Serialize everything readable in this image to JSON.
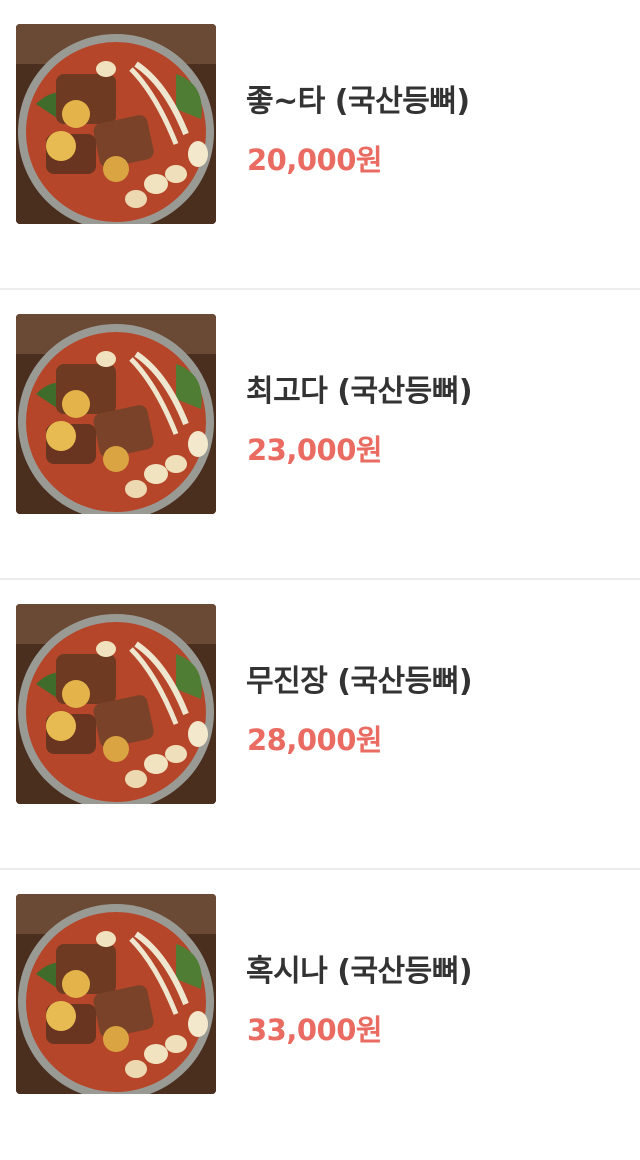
{
  "menu": {
    "items": [
      {
        "name": "좋~타 (국산등뼈)",
        "price": "20,000원",
        "image": "pork-bone-stew-photo"
      },
      {
        "name": "최고다 (국산등뼈)",
        "price": "23,000원",
        "image": "pork-bone-stew-photo"
      },
      {
        "name": "무진장 (국산등뼈)",
        "price": "28,000원",
        "image": "pork-bone-stew-photo"
      },
      {
        "name": "혹시나 (국산등뼈)",
        "price": "33,000원",
        "image": "pork-bone-stew-photo"
      }
    ]
  },
  "colors": {
    "price": "#e96b62",
    "name": "#333333",
    "divider": "#ececec"
  }
}
